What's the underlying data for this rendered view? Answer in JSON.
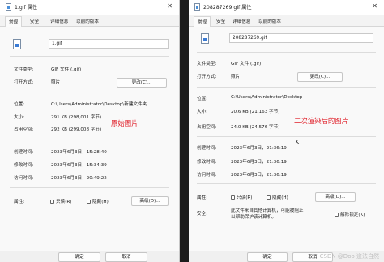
{
  "left": {
    "title": "1.gif 属性",
    "close": "✕",
    "tabs": [
      "常规",
      "安全",
      "详细信息",
      "以前的版本"
    ],
    "filename": "1.gif",
    "rows": [
      {
        "label": "文件类型:",
        "value": "GIF 文件 (.gif)"
      },
      {
        "label": "打开方式:",
        "value": "照片"
      },
      {
        "label": "位置:",
        "value": "C:\\Users\\Administrator\\Desktop\\新建文件夹"
      },
      {
        "label": "大小:",
        "value": "291 KB (298,001 字节)"
      },
      {
        "label": "占用空间:",
        "value": "292 KB (299,008 字节)"
      },
      {
        "label": "创建时间:",
        "value": "2023年6月3日，15:28:40"
      },
      {
        "label": "修改时间:",
        "value": "2023年6月3日，15:34:39"
      },
      {
        "label": "访问时间:",
        "value": "2023年6月3日，20:49:22"
      },
      {
        "label": "属性:",
        "value": ""
      }
    ],
    "change_button": "更改(C)...",
    "readonly": "只读(R)",
    "hidden": "隐藏(H)",
    "advanced_button": "高级(D)...",
    "annotation": "原始图片",
    "ok_button": "确定",
    "cancel_button": "取消"
  },
  "right": {
    "title": "208287269.gif 属性",
    "close": "✕",
    "tabs": [
      "常规",
      "安全",
      "详细信息",
      "以前的版本"
    ],
    "filename": "208287269.gif",
    "rows": [
      {
        "label": "文件类型:",
        "value": "GIF 文件 (.gif)"
      },
      {
        "label": "打开方式:",
        "value": "照片"
      },
      {
        "label": "位置:",
        "value": "C:\\Users\\Administrator\\Desktop"
      },
      {
        "label": "大小:",
        "value": "20.6 KB (21,163 字节)"
      },
      {
        "label": "占用空间:",
        "value": "24.0 KB (24,576 字节)"
      },
      {
        "label": "创建时间:",
        "value": "2023年6月3日，21:36:19"
      },
      {
        "label": "修改时间:",
        "value": "2023年6月3日，21:36:19"
      },
      {
        "label": "访问时间:",
        "value": "2023年6月3日，21:36:19"
      },
      {
        "label": "属性:",
        "value": ""
      },
      {
        "label": "安全:",
        "value": ""
      }
    ],
    "change_button": "更改(C)...",
    "readonly": "只读(R)",
    "hidden": "隐藏(H)",
    "advanced_button": "高级(D)...",
    "security_line1": "此文件来自其他计算机，可能被阻止",
    "security_line2": "以帮助保护该计算机。",
    "unblock": "解除锁定(K)",
    "annotation": "二次渲染后的图片",
    "ok_button": "确定",
    "cancel_button": "取消"
  },
  "watermark": "CSDN @Doo 道法自然"
}
